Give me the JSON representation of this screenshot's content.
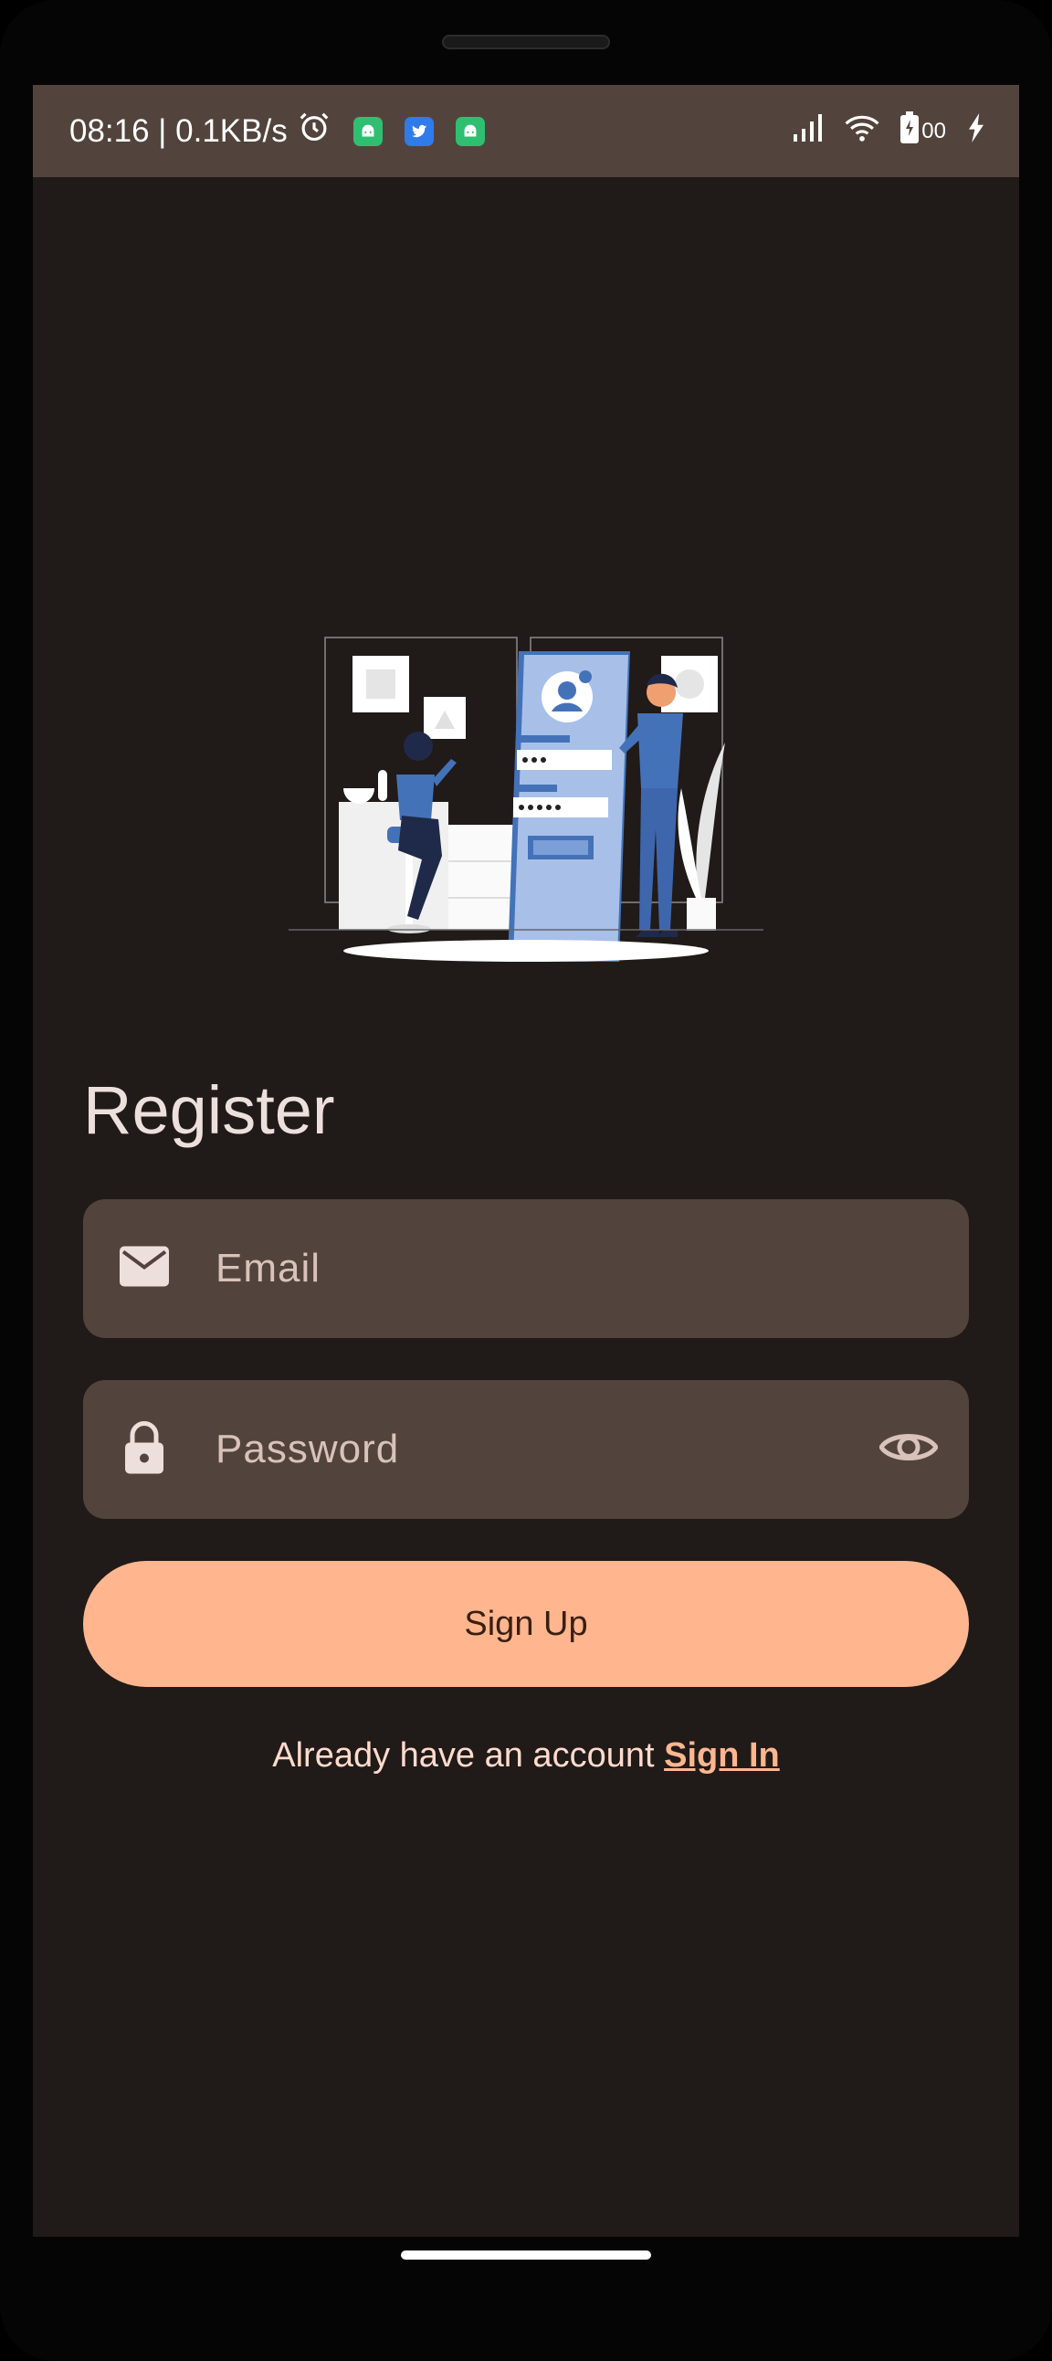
{
  "status_bar": {
    "time_speed": "08:16 | 0.1KB/s",
    "battery": "00",
    "icons": [
      "alarm-icon",
      "android-app-icon",
      "twitter-icon",
      "android-app-icon",
      "signal-icon",
      "wifi-icon",
      "battery-icon",
      "charging-icon"
    ]
  },
  "page": {
    "title": "Register"
  },
  "form": {
    "email_placeholder": "Email",
    "password_placeholder": "Password",
    "signup_label": "Sign Up"
  },
  "footer": {
    "already_text": "Already have an account",
    "signin_link": "Sign In"
  },
  "colors": {
    "background": "#201a18",
    "surface": "#52443c",
    "accent": "#ffb68f",
    "on_surface": "#ede0dc"
  }
}
